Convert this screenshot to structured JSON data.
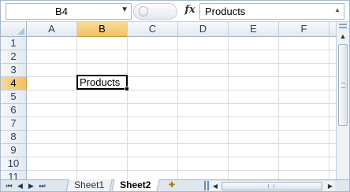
{
  "name_box": {
    "value": "B4",
    "dropdown_icon": "chevron-down-icon"
  },
  "formula_bar": {
    "fx_label": "fx",
    "value": "Products"
  },
  "columns": [
    "A",
    "B",
    "C",
    "D",
    "E",
    "F"
  ],
  "rows": [
    "1",
    "2",
    "3",
    "4",
    "5",
    "6",
    "7",
    "8",
    "9",
    "10",
    "11"
  ],
  "active_cell": {
    "ref": "B4",
    "value": "Products"
  },
  "sheet_tabs": [
    {
      "label": "Sheet1",
      "active": false
    },
    {
      "label": "Sheet2",
      "active": true
    }
  ],
  "tab_nav": {
    "first": "⏮",
    "prev": "◀",
    "next": "▶",
    "last": "⏭"
  },
  "colors": {
    "header_active": "#f1c15f",
    "grid_line": "#dadcdd",
    "header_border": "#9eb6ce"
  }
}
